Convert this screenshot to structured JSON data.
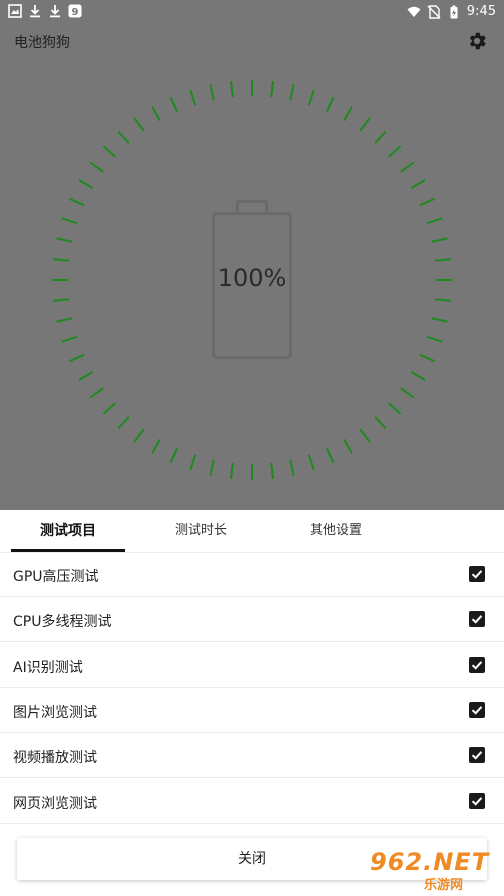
{
  "status_bar": {
    "time": "9:45",
    "icons_left": [
      "gallery-icon",
      "download-icon",
      "download-icon",
      "notification-9-icon"
    ],
    "icons_right": [
      "wifi-icon",
      "no-sim-icon",
      "battery-charging-icon"
    ]
  },
  "app_bar": {
    "title": "电池狗狗",
    "settings_icon": "gear-icon"
  },
  "battery": {
    "percent_label": "100%",
    "level": 1.0,
    "tick_color": "#1e8a1e"
  },
  "tabs": [
    {
      "label": "测试项目",
      "active": true
    },
    {
      "label": "测试时长",
      "active": false
    },
    {
      "label": "其他设置",
      "active": false
    }
  ],
  "test_items": [
    {
      "label": "GPU高压测试",
      "checked": true
    },
    {
      "label": "CPU多线程测试",
      "checked": true
    },
    {
      "label": "AI识别测试",
      "checked": true
    },
    {
      "label": "图片浏览测试",
      "checked": true
    },
    {
      "label": "视频播放测试",
      "checked": true
    },
    {
      "label": "网页浏览测试",
      "checked": true
    }
  ],
  "close_button": {
    "label": "关闭"
  },
  "watermark": {
    "text": "962.NET",
    "sub": "乐游网"
  }
}
